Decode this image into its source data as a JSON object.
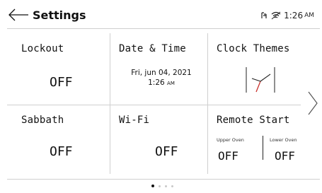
{
  "header": {
    "title": "Settings",
    "time": "1:26",
    "ampm": "AM"
  },
  "tiles": {
    "lockout": {
      "label": "Lockout",
      "value": "OFF"
    },
    "date_time": {
      "label": "Date & Time",
      "date": "Fri, jun 04, 2021",
      "time": "1:26",
      "ampm": "AM"
    },
    "clock_themes": {
      "label": "Clock Themes"
    },
    "sabbath": {
      "label": "Sabbath",
      "value": "OFF"
    },
    "wifi": {
      "label": "Wi-Fi",
      "value": "OFF"
    },
    "remote_start": {
      "label": "Remote Start",
      "upper_label": "Upper Oven",
      "upper_value": "OFF",
      "lower_label": "Lower Oven",
      "lower_value": "OFF"
    }
  },
  "pagination": {
    "current_page": 1,
    "total_pages": 4
  },
  "colors": {
    "clock_hand_accent": "#c9302c",
    "divider": "#cfcfcf"
  }
}
